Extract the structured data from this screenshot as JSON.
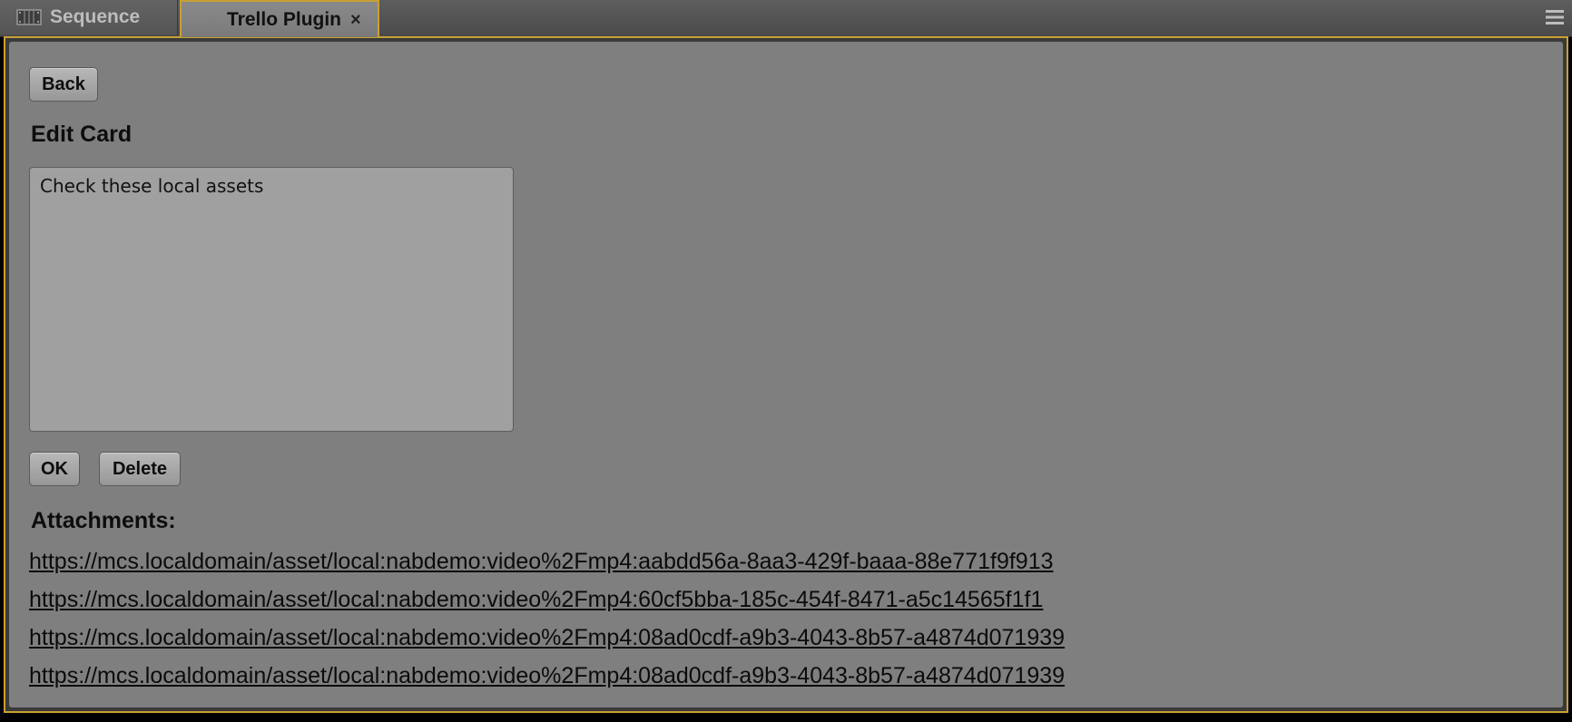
{
  "tabs": {
    "sequence": {
      "label": "Sequence",
      "icon": "filmstrip-icon"
    },
    "trello": {
      "label": "Trello Plugin",
      "close_glyph": "×"
    },
    "menu_icon": "hamburger-menu-icon"
  },
  "toolbar": {
    "back_label": "Back"
  },
  "edit_card": {
    "heading": "Edit Card",
    "text_value": "Check these local assets",
    "ok_label": "OK",
    "delete_label": "Delete"
  },
  "attachments": {
    "title": "Attachments:",
    "links": [
      "https://mcs.localdomain/asset/local:nabdemo:video%2Fmp4:aabdd56a-8aa3-429f-baaa-88e771f9f913",
      "https://mcs.localdomain/asset/local:nabdemo:video%2Fmp4:60cf5bba-185c-454f-8471-a5c14565f1f1",
      "https://mcs.localdomain/asset/local:nabdemo:video%2Fmp4:08ad0cdf-a9b3-4043-8b57-a4874d071939",
      "https://mcs.localdomain/asset/local:nabdemo:video%2Fmp4:08ad0cdf-a9b3-4043-8b57-a4874d071939"
    ]
  },
  "colors": {
    "accent_border": "#c8a032",
    "panel_background": "#7f7f7f",
    "textarea_background": "#a0a0a0"
  }
}
